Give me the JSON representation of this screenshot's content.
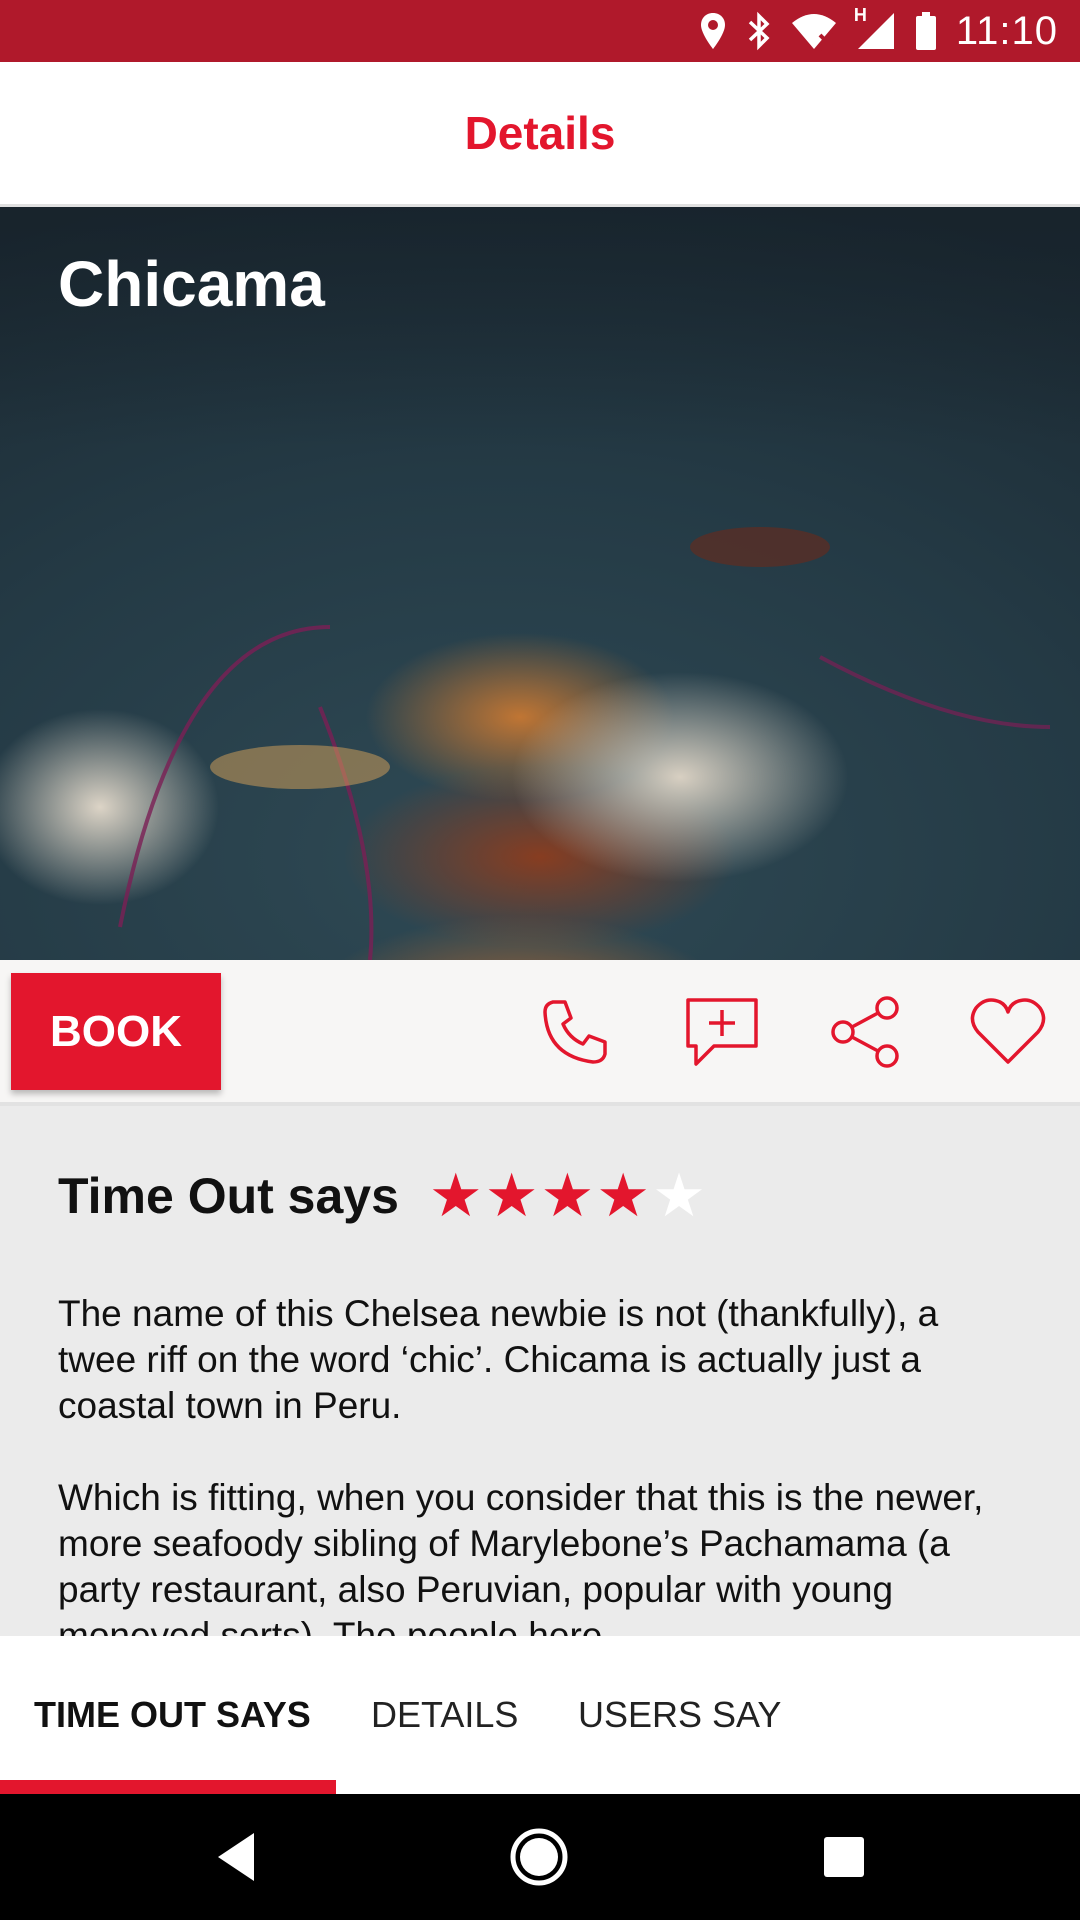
{
  "status_bar": {
    "time": "11:10",
    "network_label": "H",
    "icons": [
      "location-icon",
      "bluetooth-icon",
      "wifi-icon",
      "signal-icon",
      "battery-icon"
    ],
    "background": "#b0192b"
  },
  "app_bar": {
    "title": "Details",
    "accent": "#e3162d"
  },
  "venue": {
    "name": "Chicama"
  },
  "actions": {
    "book_label": "BOOK",
    "icons": [
      "phone-icon",
      "add-comment-icon",
      "share-icon",
      "heart-icon"
    ]
  },
  "review": {
    "heading": "Time Out says",
    "rating": 4,
    "rating_max": 5,
    "paragraphs": [
      "The name of this Chelsea newbie is not (thankfully), a twee riff on the word ‘chic’. Chicama is actually just a coastal town in Peru.",
      "Which is fitting, when you consider that this is the newer, more seafoody sibling of Marylebone’s Pachamama (a party restaurant, also Peruvian, popular with young moneyed sorts). The people here"
    ]
  },
  "tabs": [
    {
      "label": "TIME OUT SAYS",
      "active": true
    },
    {
      "label": "DETAILS",
      "active": false
    },
    {
      "label": "USERS SAY",
      "active": false
    }
  ],
  "nav_bar": {
    "icons": [
      "back-icon",
      "home-icon",
      "recents-icon"
    ]
  }
}
